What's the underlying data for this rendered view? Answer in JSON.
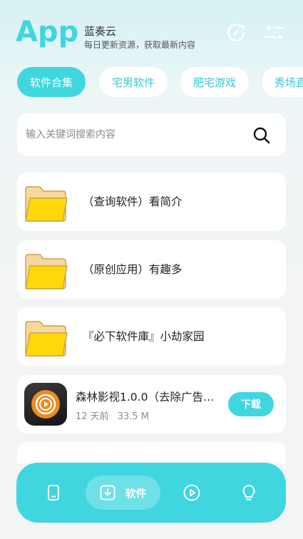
{
  "header": {
    "logo": "App",
    "app_name": "蓝奏云",
    "subtitle": "每日更新资源，获取最新内容",
    "icons": [
      "refresh-icon",
      "sliders-icon"
    ]
  },
  "tabs": [
    {
      "label": "软件合集",
      "active": true
    },
    {
      "label": "宅男软件",
      "active": false
    },
    {
      "label": "肥宅游戏",
      "active": false
    },
    {
      "label": "秀场直",
      "active": false
    }
  ],
  "search": {
    "placeholder": "输入关键词搜索内容",
    "value": "",
    "icon": "search-icon"
  },
  "folders": [
    {
      "title": "（查询软件）看简介",
      "icon": "folder-icon"
    },
    {
      "title": "（原创应用）有趣多",
      "icon": "folder-icon"
    },
    {
      "title": "『必下软件庫』小劫家园",
      "icon": "folder-icon"
    }
  ],
  "app_item": {
    "title": "森林影视1.0.0（去除广告…",
    "age": "12 天前",
    "size": "33.5 M",
    "button": "下载",
    "icon": "video-app-icon"
  },
  "bottom_nav": [
    {
      "icon": "phone-icon",
      "label": ""
    },
    {
      "icon": "download-icon",
      "label": "软件",
      "active": true
    },
    {
      "icon": "play-icon",
      "label": ""
    },
    {
      "icon": "bulb-icon",
      "label": ""
    }
  ],
  "colors": {
    "accent": "#3fd6e0",
    "tab_text": "#37c9d6",
    "card": "#ffffff",
    "folder": "#f5cd12"
  }
}
